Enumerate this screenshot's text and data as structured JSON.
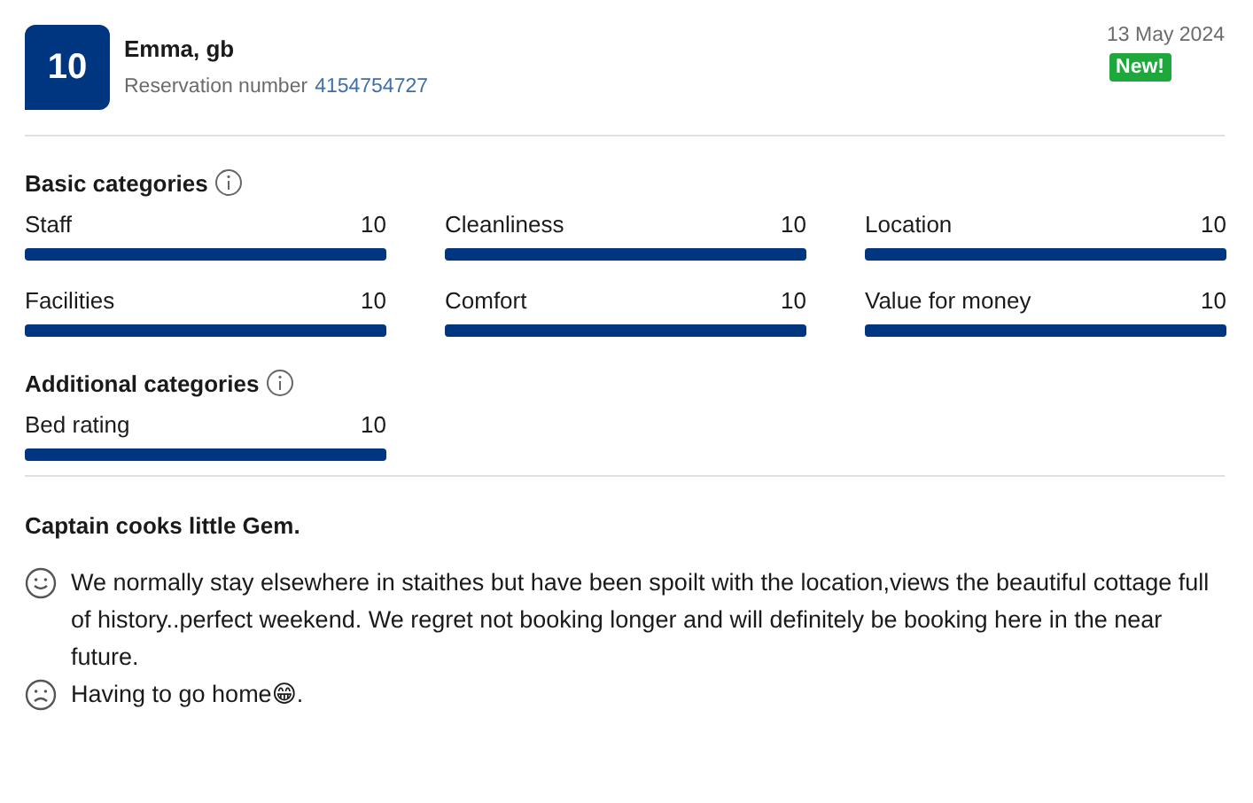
{
  "score": "10",
  "reviewer": {
    "name": "Emma, gb",
    "reservation_label": "Reservation number",
    "reservation_number": "4154754727"
  },
  "date": "13 May 2024",
  "badge": "New!",
  "sections": [
    {
      "title": "Basic categories",
      "items": [
        {
          "label": "Staff",
          "score": "10",
          "level": 1
        },
        {
          "label": "Cleanliness",
          "score": "10",
          "level": 1
        },
        {
          "label": "Location",
          "score": "10",
          "level": 1
        },
        {
          "label": "Facilities",
          "score": "10",
          "level": 1
        },
        {
          "label": "Comfort",
          "score": "10",
          "level": 1
        },
        {
          "label": "Value for money",
          "score": "10",
          "level": 1
        }
      ]
    },
    {
      "title": "Additional categories",
      "items": [
        {
          "label": "Bed rating",
          "score": "10",
          "level": 1
        }
      ]
    }
  ],
  "review": {
    "title": "Captain cooks little Gem.",
    "comments": [
      {
        "kind": "positive",
        "text": "We normally stay elsewhere in staithes but have been spoilt with the location,views the beautiful cottage full of history..perfect weekend. We regret not booking longer and will definitely be booking here in the near future."
      },
      {
        "kind": "negative",
        "text": "Having to go home😁."
      }
    ]
  }
}
